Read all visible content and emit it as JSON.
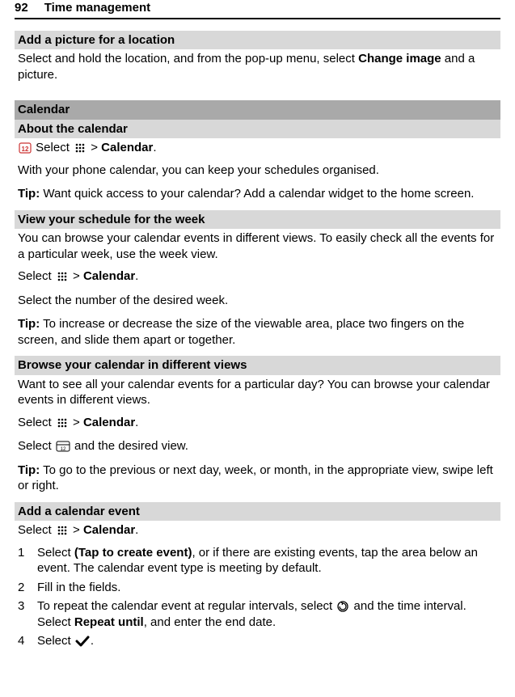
{
  "header": {
    "page_num": "92",
    "chapter": "Time management"
  },
  "sec1": {
    "title": "Add a picture for a location",
    "p1a": "Select and hold the location, and from the pop-up menu, select ",
    "p1b": "Change image",
    "p1c": " and a picture."
  },
  "sec2": {
    "title": "Calendar",
    "sub1": "About the calendar",
    "p1a": " Select ",
    "p1b": " > ",
    "p1c": "Calendar",
    "p1d": ".",
    "p2": "With your phone calendar, you can keep your schedules organised.",
    "tip1a": "Tip:",
    "tip1b": " Want quick access to your calendar? Add a calendar widget to the home screen."
  },
  "sec3": {
    "title": "View your schedule for the week",
    "p1": "You can browse your calendar events in different views. To easily check all the events for a particular week, use the week view.",
    "p2a": "Select ",
    "p2b": " > ",
    "p2c": "Calendar",
    "p2d": ".",
    "p3": "Select the number of the desired week.",
    "tip1a": "Tip:",
    "tip1b": " To increase or decrease the size of the viewable area, place two fingers on the screen, and slide them apart or together."
  },
  "sec4": {
    "title": "Browse your calendar in different views",
    "p1": "Want to see all your calendar events for a particular day? You can browse your calendar events in different views.",
    "p2a": "Select ",
    "p2b": " > ",
    "p2c": "Calendar",
    "p2d": ".",
    "p3a": "Select ",
    "p3b": " and the desired view.",
    "tip1a": "Tip:",
    "tip1b": " To go to the previous or next day, week, or month, in the appropriate view, swipe left or right."
  },
  "sec5": {
    "title": "Add a calendar event",
    "p1a": "Select ",
    "p1b": " > ",
    "p1c": "Calendar",
    "p1d": ".",
    "li1n": "1",
    "li1a": "Select ",
    "li1b": "(Tap to create event)",
    "li1c": ", or if there are existing events, tap the area below an event. The calendar event type is meeting by default.",
    "li2n": "2",
    "li2": "Fill in the fields.",
    "li3n": "3",
    "li3a": "To repeat the calendar event at regular intervals, select ",
    "li3b": " and the time interval. Select ",
    "li3c": "Repeat until",
    "li3d": ", and enter the end date.",
    "li4n": "4",
    "li4a": "Select ",
    "li4b": "."
  }
}
